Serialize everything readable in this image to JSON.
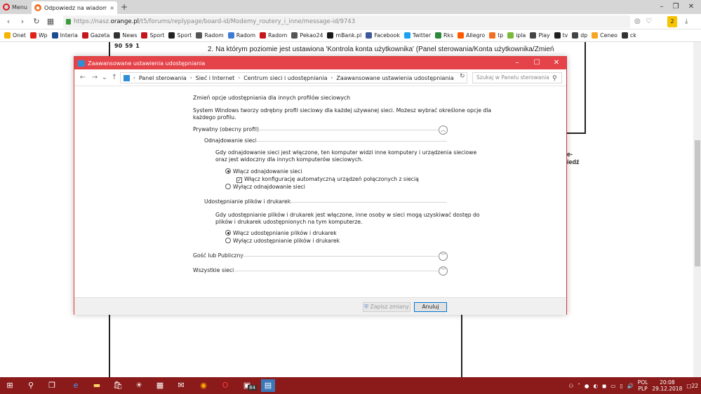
{
  "browser": {
    "menu_label": "Menu",
    "tab_title": "Odpowiedz na wiadomość",
    "tab_close": "×",
    "new_tab": "+",
    "url_prefix": "https://nasz.",
    "url_host": "orange.pl",
    "url_path": "/t5/forums/replypage/board-id/Modemy_routery_i_inne/message-id/9743",
    "bookmarks": [
      {
        "label": "Onet",
        "color": "#f5b400"
      },
      {
        "label": "Wp",
        "color": "#e2231a"
      },
      {
        "label": "Interia",
        "color": "#1c4c8f"
      },
      {
        "label": "Gazeta",
        "color": "#c4161c"
      },
      {
        "label": "News",
        "color": "#333333"
      },
      {
        "label": "Sport",
        "color": "#c4161c"
      },
      {
        "label": "Sport",
        "color": "#222222"
      },
      {
        "label": "Radom",
        "color": "#555555"
      },
      {
        "label": "Radom",
        "color": "#3d7bd6"
      },
      {
        "label": "Radom",
        "color": "#c4161c"
      },
      {
        "label": "Pekao24",
        "color": "#555555"
      },
      {
        "label": "mBank.pl",
        "color": "#1a1a1a"
      },
      {
        "label": "Facebook",
        "color": "#3b5998"
      },
      {
        "label": "Twitter",
        "color": "#1da1f2"
      },
      {
        "label": "Rks",
        "color": "#2a8a3a"
      },
      {
        "label": "Allegro",
        "color": "#ff5a00"
      },
      {
        "label": "tp",
        "color": "#f36f21"
      },
      {
        "label": "ipla",
        "color": "#7bb93b"
      },
      {
        "label": "Play",
        "color": "#444444"
      },
      {
        "label": "tv",
        "color": "#222222"
      },
      {
        "label": "dp",
        "color": "#444444"
      },
      {
        "label": "Ceneo",
        "color": "#f5a623"
      },
      {
        "label": "ck",
        "color": "#333333"
      }
    ],
    "badge_count": "2"
  },
  "page": {
    "votes": [
      "90",
      "59",
      "1"
    ],
    "line2": "2. Na którym poziomie jest ustawiona 'Kontrola konta użytkownika' (Panel sterowania/Konta użytkownika/Zmień",
    "side_text_1": "e-",
    "side_text_2": "iedź"
  },
  "dialog": {
    "title": "Zaawansowane ustawienia udostępniania",
    "breadcrumb": [
      "Panel sterowania",
      "Sieć i Internet",
      "Centrum sieci i udostępniania",
      "Zaawansowane ustawienia udostępniania"
    ],
    "search_placeholder": "Szukaj w Panelu sterowania",
    "heading": "Zmień opcje udostępniania dla innych profilów sieciowych",
    "intro_1": "System Windows tworzy odrębny profil sieciowy dla każdej używanej sieci. Możesz wybrać określone opcje dla",
    "intro_2": "każdego profilu.",
    "private_profile": "Prywatny (obecny profil)",
    "discovery": {
      "title": "Odnajdowanie sieci",
      "desc_1": "Gdy odnajdowanie sieci jest włączone, ten komputer widzi inne komputery i urządzenia sieciowe",
      "desc_2": "oraz jest widoczny dla innych komputerów sieciowych.",
      "opt_on": "Włącz odnajdowanie sieci",
      "opt_auto": "Włącz konfigurację automatyczną urządzeń połączonych z siecią",
      "opt_off": "Wyłącz odnajdowanie sieci"
    },
    "sharing": {
      "title": "Udostępnianie plików i drukarek",
      "desc_1": "Gdy udostępnianie plików i drukarek jest włączone, inne osoby w sieci mogą uzyskiwać dostęp do",
      "desc_2": "plików i drukarek udostępnionych na tym komputerze.",
      "opt_on": "Włącz udostępnianie plików i drukarek",
      "opt_off": "Wyłącz udostępnianie plików i drukarek"
    },
    "guest_profile": "Gość lub Publiczny",
    "all_networks": "Wszystkie sieci",
    "save_label": "Zapisz zmiany",
    "cancel_label": "Anuluj"
  },
  "taskbar": {
    "lang_1": "POL",
    "lang_2": "PLP",
    "time": "20:08",
    "date": "29.12.2018",
    "notif_count": "22",
    "app_badge": "84"
  }
}
